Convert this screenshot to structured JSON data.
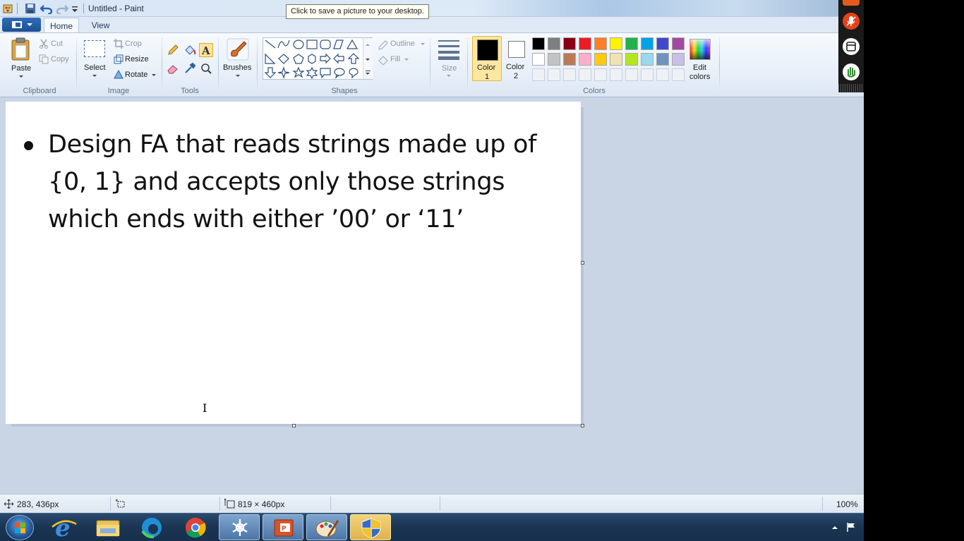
{
  "window": {
    "title": "Untitled - Paint"
  },
  "tooltip": "Click to save a picture to your desktop.",
  "tabs": [
    {
      "label": "Home"
    },
    {
      "label": "View"
    }
  ],
  "ribbon": {
    "clipboard": {
      "group": "Clipboard",
      "paste": "Paste",
      "cut": "Cut",
      "copy": "Copy"
    },
    "image": {
      "group": "Image",
      "select": "Select",
      "crop": "Crop",
      "resize": "Resize",
      "rotate": "Rotate"
    },
    "tools": {
      "group": "Tools"
    },
    "brushes": {
      "label": "Brushes"
    },
    "shapes": {
      "group": "Shapes",
      "outline": "Outline",
      "fill": "Fill"
    },
    "size": {
      "label": "Size"
    },
    "colors": {
      "group": "Colors",
      "color1_line1": "Color",
      "color1_line2": "1",
      "color2_line1": "Color",
      "color2_line2": "2",
      "edit_line1": "Edit",
      "edit_line2": "colors",
      "color1_value": "#000000",
      "color2_value": "#ffffff",
      "palette_row1": [
        "#000000",
        "#7f7f7f",
        "#880015",
        "#ed1c24",
        "#ff7f27",
        "#fff200",
        "#22b14c",
        "#00a2e8",
        "#3f48cc",
        "#a349a4"
      ],
      "palette_row2": [
        "#ffffff",
        "#c3c3c3",
        "#b97a57",
        "#ffaec9",
        "#ffc90e",
        "#efe4b0",
        "#b5e61d",
        "#99d9ea",
        "#7092be",
        "#c8bfe7"
      ]
    }
  },
  "canvas": {
    "lines": [
      "Design FA that reads strings made up of",
      "{0, 1} and accepts only those strings",
      "which ends with either  ’00’ or ‘11’"
    ]
  },
  "status": {
    "cursor_pos": "283, 436px",
    "image_size": "819 × 460px",
    "zoom": "100%"
  }
}
